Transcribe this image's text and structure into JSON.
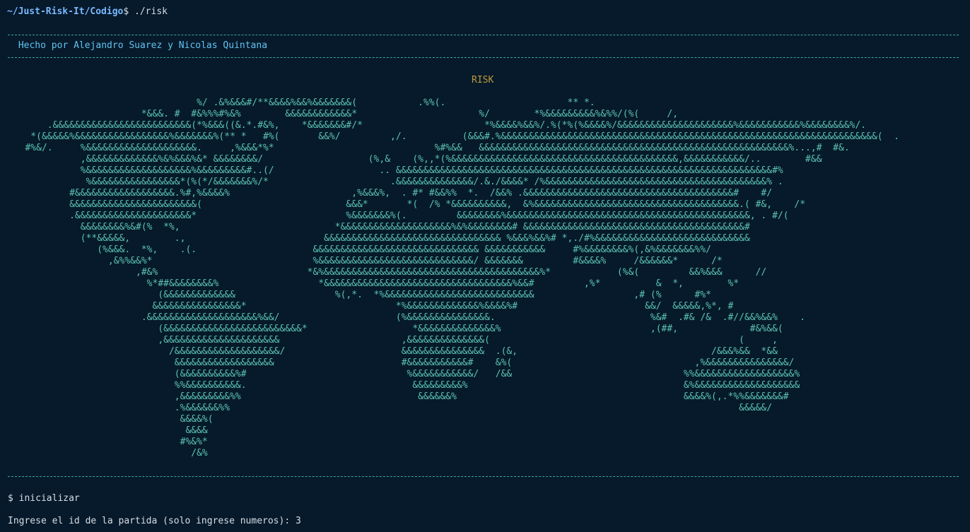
{
  "terminal": {
    "prompt_path": "~/Just-Risk-It/Codigo",
    "prompt_suffix": "$ ./risk",
    "credits": " Hecho por Alejandro Suarez y Nicolas Quintana",
    "game_title": "RISK",
    "world_map_ascii": "                                  %/ .&%&&&#/**&&&&%&&%&&&&&&&(           .%%(.                      ** *.\n                        *&&&. #  #&%%%#%&%        &&&&&&&&&&&&*                      %/        *%&&&&&&&&&%&%%/(%(     /,\n       .&&&&&&&&&&&&&&&&&&&&&&&&&(*%&&&((&.*.#&%,    *&&&&&&&#/*                      *%&&&&%&&%/.%(*%(%&&&&%/&&&&&&&&&&&&&&&&&&&&&%&&&&&&&&&&&%&&&&&&&&%/.\n    *(&&&&&%&&&&&&&&&&&&&&&&&%&&&&&&&%(** *   #%(       &&%/         ,/.          (&&&#.%&&&&&&&&&&&&&&&&&&&&&&&&&&&&&&&&&&&&&&&&&&&&&&&&&&&&&&&&&&&&&&&&&&&&(  .\n   #%&/.     %&&&&&&&&&&&&&&&&&&&&.     ,%&&&*%*                             %#%&&   &&&&&&&&&&&&&&&&&&&&&&&&&&&&&&&&&&&&&&&&&&&&&&&&&&&&&&&&%...,#  #&.\n             ,&&&&&&&&&&&&&%&%&&&%&* &&&&&&&&/                   (%,&    (%,,*(%&&&&&&&&&&&&&&&&&&&&&&&&&&&&&&&&&&&&&&&&&,&&&&&&&&&&&/..        #&&\n             %&&&&&&&&&&&&&&&&&&&%&&&&&&&&&#..(/                   .. &&&&&&&&&&&&&&&&&&&&&&&&&&&&&&&&&&&&&&&&&&&&&&&&&&&&&&&&&&&&&&&&&&&&#%\n              %&&&&&&&&&&&&&&&&*(%(*/&&&&&&&%/*                      .&&&&&&&&&&&&&&/.&./&&&&* /%&&&&&&&&&&&&&&&&&&&&&&&&&&&&&&&&&&&&&&&&% .\n           #&&&&&&&&&&&&&&&&&&.%#,%&&&&%                      ,%&&&%,  . #* #&&%%  *.  /&&% .&&&&&&&&&&&&&&&&&&&&&&&&&&&&&&&&&&&&&&#    #/\n           &&&&&&&&&&&&&&&&&&&&&&&(                          &&&*       *(  /% *&&&&&&&&&&,  &%&&&&&&&&&&&&&&&&&&&&&&&&&&&&&&&&&&&&&.( #&,    /*\n           .&&&&&&&&&&&&&&&&&&&&&*                           %&&&&&&&%(.         &&&&&&&&%&&&&&&&&&&&&&&&&&&&&&&&&&&&&&&&&&&&&&&&&&&&&, . #/(\n             &&&&&&&&%&#(%  *%,                            *&&&&&&&&&&&&&&&&&&&&%&%&&&&&&&&# &&&&&&&&&&&&&&&&&&&&&&&&&&&&&&&&&&&&&&&&#\n             (**&&&&&,        .,                         &&&&&&&&&&&&&&&&&&&&&&&&&&&&&&&& %&&&%&&%# *,./#%&&&&&&&&&&&&&&&&&&&&&&&&&&&&\n                (%&&&.  *%,    .(.                     &&&&&&&&&&&&&&&&&&&&&&&&&&&&&& &&&&&&&&&&&     #%&&&&&&&&%(,&%&&&&&&&%%/\n                  ,&%%&&%*                             %&&&&&&&&&&&&&&&&&&&&&&&&&&&&/ &&&&&&&         #&&&&%     /&&&&&&*      /*\n                       ,#&%                           *&%&&&&&&&&&&&&&&&&&&&&&&&&&&&&&&&&&&&&&&&%*            (%&(         &&%&&&      //\n                         %*##&&&&&&&&%                  *&&&&&&&&&&&&&&&&&&&&&&&&&&&&&&&&&&%&&#         ,%*          &  *,        %*\n                           (&&&&&&&&&&&&&                  %(,*.  *%&&&&&&&&&&&&&&&&&&&&&&&&&&&                  ,# (%      #%*\n                          &&&&&&&&&&&&&&&&*                           *%&&&&&&&&&&&&&%&&&&%#                       &&/  &&&&&,%*, #\n                        .&&&&&&&&&&&&&&&&&&&&%&&/                     (%&&&&&&&&&&&&&&&.                            %&#  .#& /&  .#//&&%&&%    .\n                           (&&&&&&&&&&&&&&&&&&&&&&&&&*                   *&&&&&&&&&&&&&&%                           ,(##,             #&%&&(\n                           ,&&&&&&&&&&&&&&&&&&&&&                      ,&&&&&&&&&&&&&&(                                             (     ,\n                             /&&&&&&&&&&&&&&&&&&&/                     &&&&&&&&&&&&&&&  .(&,                                   /&&&%&&  *&&\n                              &&&&&&&&&&&&&&&&&&                       #&&&&&&&&&&&#    &%(                                 ,%&&&&&&&&&&&&&&&/\n                              (&&&&&&&&&&%#                             %&&&&&&&&&&&/   /&&                               %%&&&&&&&&&&&&&&&&&&%\n                              %%&&&&&&&&&&.                              &&&&&&&&&%                                       &%&&&&&&&&&&&&&&&&&&&\n                              ,&&&&&&&&&%%                                &&&&&&%                                         &&&&%(,.*%%&&&&&&&#\n                              .%&&&&&&%%                                                                                            &&&&&/\n                               &&&&%(\n                                &&&&\n                               #%&%*\n                                 /&%",
    "command": "$ inicializar",
    "input_prompt": "Ingrese el id de la partida (solo ingrese numeros): 3"
  },
  "colors": {
    "background": "#061a2b",
    "prompt_path": "#79b8ff",
    "credits": "#61c3f0",
    "title": "#c09a3e",
    "map": "#5cc2b4",
    "separator": "#3fa7a2"
  }
}
